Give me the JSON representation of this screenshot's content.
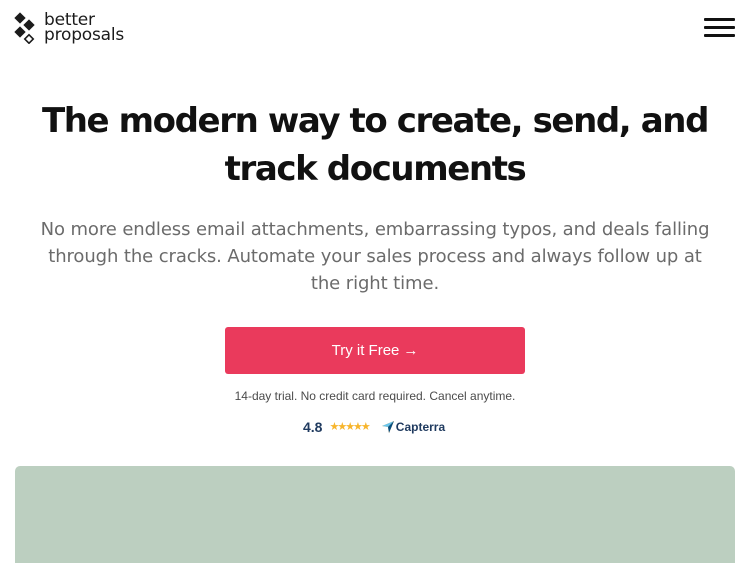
{
  "brand": {
    "line1": "better",
    "line2": "proposals",
    "logo_icon": "diamond-dots-icon",
    "logo_color": "#1b1b1b"
  },
  "header": {
    "menu_icon": "hamburger-menu-icon"
  },
  "hero": {
    "title_line1": "The modern way to create, send, and",
    "title_line2": "track documents",
    "subtitle_line1": "No more endless email attachments, embarrassing typos, and deals falling",
    "subtitle_line2": "through the cracks. Automate your sales process and always follow up at",
    "subtitle_line3": "the right time.",
    "cta_label": "Try it Free",
    "cta_arrow": "→",
    "cta_color": "#ea3a5c",
    "trial_note": "14-day trial. No credit card required. Cancel anytime."
  },
  "rating": {
    "score": "4.8",
    "stars": "★★★★★",
    "star_color": "#f7b52c",
    "source": "Capterra",
    "source_icon": "capterra-arrow-icon"
  },
  "media": {
    "panel_color": "#bccfc0"
  }
}
